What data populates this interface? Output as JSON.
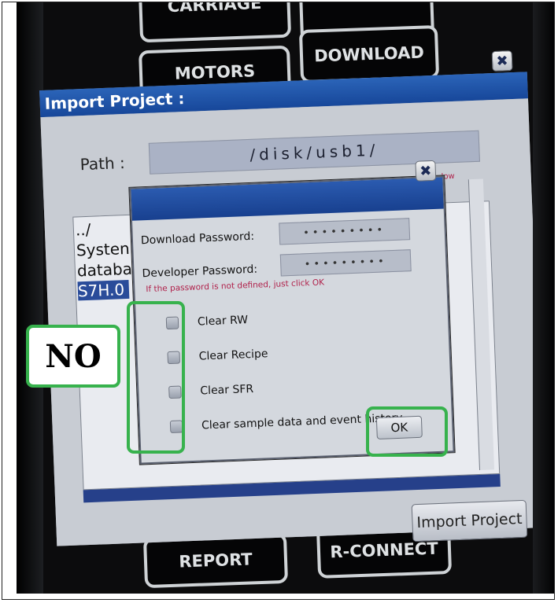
{
  "hmi_buttons": {
    "carriage": "CARRIAGE",
    "motors": "MOTORS",
    "download": "DOWNLOAD",
    "report": "REPORT",
    "r_connect": "R-CONNECT"
  },
  "import_window": {
    "title": "Import Project :",
    "close_glyph": "✖",
    "path_label": "Path :",
    "path_value": "/disk/usb1/",
    "hint_partial": "low",
    "file_list": [
      "../",
      "Systen",
      "databa",
      "S7H.0"
    ],
    "selected_index": 3,
    "import_button": "Import Project"
  },
  "password_dialog": {
    "close_glyph": "✖",
    "download_password_label": "Download Password:",
    "download_password_value": "•••••••••",
    "developer_password_label": "Developer Password:",
    "developer_password_value": "•••••••••",
    "hint": "If the password is not defined, just click OK",
    "options": [
      {
        "label": "Clear RW",
        "checked": false
      },
      {
        "label": "Clear Recipe",
        "checked": false
      },
      {
        "label": "Clear SFR",
        "checked": false
      },
      {
        "label": "Clear sample data and event history",
        "checked": false
      }
    ],
    "ok_button": "OK"
  },
  "annotation": {
    "label": "NO",
    "color": "#37b24d"
  }
}
